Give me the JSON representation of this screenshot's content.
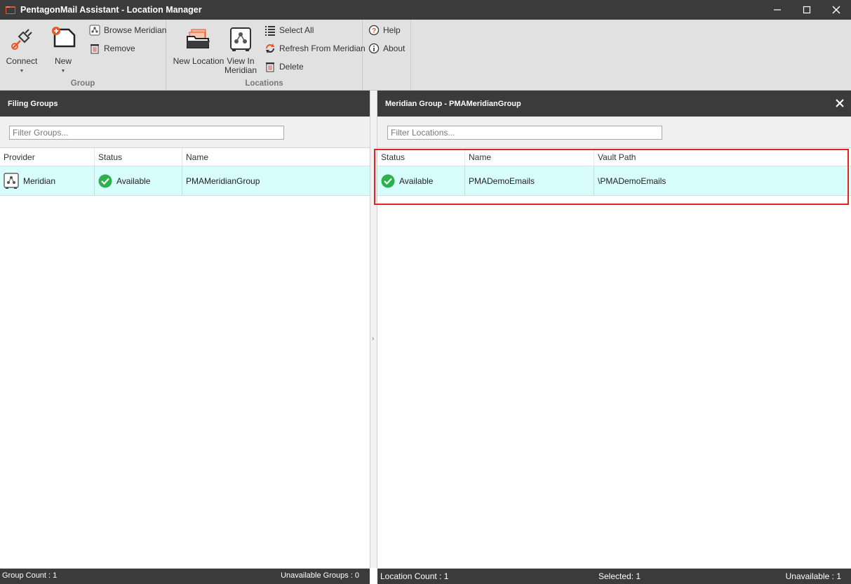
{
  "window": {
    "title": "PentagonMail Assistant - Location Manager"
  },
  "ribbon": {
    "group": {
      "label": "Group",
      "connect_label": "Connect",
      "new_label": "New",
      "browse_meridian_label": "Browse Meridian",
      "remove_label": "Remove"
    },
    "locations": {
      "label": "Locations",
      "new_location_label": "New Location",
      "view_in_meridian_line1": "View In",
      "view_in_meridian_line2": "Meridian",
      "select_all_label": "Select All",
      "refresh_label": "Refresh From Meridian",
      "delete_label": "Delete"
    },
    "help": {
      "help_label": "Help",
      "about_label": "About"
    }
  },
  "left_panel": {
    "title": "Filing Groups",
    "filter_placeholder": "Filter Groups...",
    "columns": [
      "Provider",
      "Status",
      "Name"
    ],
    "rows": [
      {
        "provider": "Meridian",
        "status": "Available",
        "name": "PMAMeridianGroup"
      }
    ],
    "status": {
      "group_count": "Group Count : 1",
      "unavailable_groups": "Unavailable Groups : 0"
    }
  },
  "right_panel": {
    "title": "Meridian Group - PMAMeridianGroup",
    "filter_placeholder": "Filter Locations...",
    "columns": [
      "Status",
      "Name",
      "Vault Path"
    ],
    "rows": [
      {
        "status": "Available",
        "name": "PMADemoEmails",
        "vault_path": "\\PMADemoEmails"
      }
    ],
    "status": {
      "location_count": "Location Count : 1",
      "selected": "Selected: 1",
      "unavailable": "Unavailable : 1"
    }
  },
  "colors": {
    "dark_bar": "#3b3b3b",
    "ribbon_bg": "#e1e1e1",
    "selected_row": "#d7fdfd",
    "available_green": "#2bb24c",
    "highlight_red": "#e02424",
    "accent_orange": "#e8562a"
  },
  "icons": {
    "connect": "plug-icon",
    "new": "new-document-icon",
    "browse_meridian": "meridian-icon",
    "remove": "trash-icon",
    "new_location": "folder-stack-icon",
    "view_in_meridian": "meridian-vault-icon",
    "select_all": "list-icon",
    "refresh": "refresh-icon",
    "delete": "trash-icon",
    "help": "help-icon",
    "about": "info-icon",
    "status_available": "check-circle-icon"
  }
}
